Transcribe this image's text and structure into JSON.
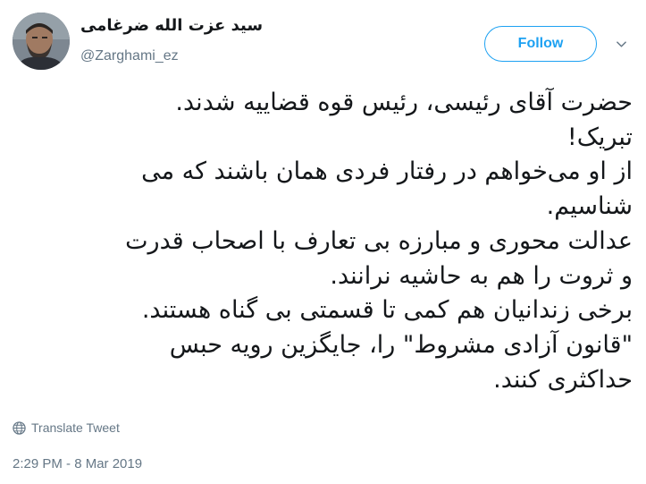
{
  "author": {
    "display_name": "سید عزت الله ضرغامی",
    "handle": "@Zarghami_ez"
  },
  "follow_button": {
    "label": "Follow"
  },
  "tweet": {
    "lines": [
      "حضرت آقای رئیسی، رئیس قوه قضاییه شدند.",
      "تبریک!",
      "از او می‌خواهم در رفتار فردی همان باشند که می",
      "شناسیم.",
      "عدالت محوری و مبارزه بی تعارف با اصحاب قدرت",
      "و ثروت را هم به حاشیه نرانند.",
      "برخی زندانیان هم کمی تا قسمتی بی گناه هستند.",
      "\"قانون آزادی مشروط\" را، جایگزین رویه حبس",
      "حداکثری کنند."
    ]
  },
  "translate_link": {
    "label": "Translate Tweet",
    "icon": "globe-icon"
  },
  "timestamp": "2:29 PM - 8 Mar 2019",
  "colors": {
    "accent": "#1da1f2",
    "text": "#14171a",
    "secondary": "#657786"
  }
}
